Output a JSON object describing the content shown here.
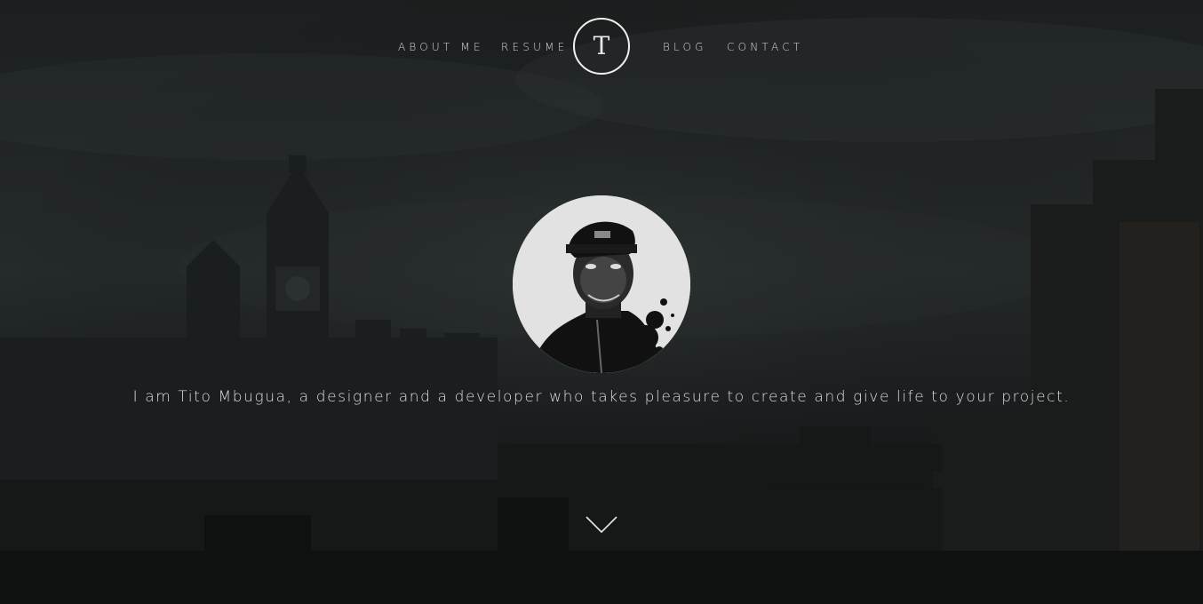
{
  "nav": {
    "about_label": "ABOUT ME",
    "resume_label": "RESUME",
    "logo_letter": "T",
    "blog_label": "BLOG",
    "contact_label": "CONTACT"
  },
  "hero": {
    "tagline": "I am Tito Mbugua, a designer and a developer who takes pleasure to create and give life to your project.",
    "scroll_icon": "chevron-down-icon"
  },
  "colors": {
    "text": "#dcdcdc",
    "background": "#141616",
    "logo_border": "#f0f0f0"
  }
}
